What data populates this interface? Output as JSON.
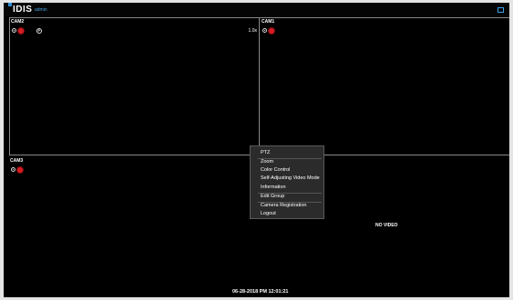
{
  "header": {
    "logo_text": "IDIS",
    "brand_tag": "admin",
    "accent_color": "#2f8fd8",
    "right_icon": "monitor-icon"
  },
  "cameras": {
    "cam2": {
      "name": "CAM2",
      "speed": "1.0x",
      "icons": [
        "record-icon",
        "alarm-icon",
        "ptz-icon"
      ]
    },
    "cam1": {
      "name": "CAM1",
      "icons": [
        "record-icon",
        "alarm-icon"
      ]
    },
    "cam3": {
      "name": "CAM3",
      "icons": [
        "record-icon",
        "alarm-icon"
      ]
    },
    "cam4": {
      "status": "NO VIDEO"
    }
  },
  "context_menu": {
    "items": [
      "PTZ",
      "Zoom",
      "Color Control",
      "Self-Adjusting Video Mode",
      "Information",
      "Edit Group",
      "Camera Registration",
      "Logout"
    ]
  },
  "status": {
    "datetime": "06-28-2018 PM 12:01:21"
  }
}
